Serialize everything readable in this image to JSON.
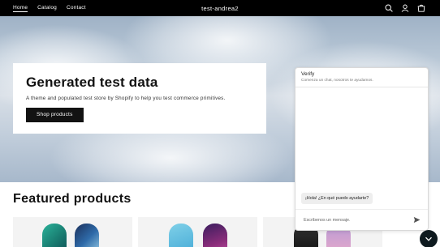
{
  "header": {
    "nav": [
      {
        "label": "Home",
        "active": true
      },
      {
        "label": "Catalog",
        "active": false
      },
      {
        "label": "Contact",
        "active": false
      }
    ],
    "brand": "test-andrea2",
    "icons": [
      "search-icon",
      "account-icon",
      "cart-icon"
    ]
  },
  "hero": {
    "title": "Generated test data",
    "subtitle": "A theme and populated test store by Shopify to help you test commerce primitives.",
    "button_label": "Shop products"
  },
  "featured": {
    "title": "Featured products"
  },
  "chat": {
    "title": "Verify",
    "subtitle": "Comenza un chat, nosotros te ayudamos.",
    "greeting": "¡Hola! ¿En qué puedo ayudarte?",
    "input_placeholder": "Escribenos un mensaje.",
    "send_icon": "send-icon",
    "toggle_icon": "chevron-down-icon"
  },
  "colors": {
    "header_bg": "#000000",
    "button_bg": "#121212",
    "chat_toggle_bg": "#0e1a1f"
  }
}
